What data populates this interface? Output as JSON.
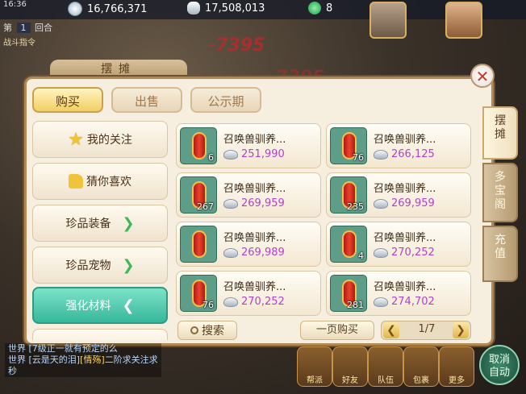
{
  "status": {
    "time": "16:36"
  },
  "currencies": [
    {
      "icon": "gold-coin-icon",
      "value": "16,766,371"
    },
    {
      "icon": "silver-ingot-icon",
      "value": "17,508,013"
    },
    {
      "icon": "jade-gem-icon",
      "value": "8"
    }
  ],
  "battle": {
    "round_label": "第",
    "round_num": "1",
    "round_unit": "回合",
    "command": "战斗指令",
    "damage1": "-7395",
    "damage2": "-7395"
  },
  "panel": {
    "title": "摆摊",
    "tabs": [
      {
        "label": "购买",
        "active": true
      },
      {
        "label": "出售",
        "active": false
      },
      {
        "label": "公示期",
        "active": false
      }
    ],
    "sidebar": [
      {
        "label": "我的关注",
        "icon": "star-icon",
        "active": false
      },
      {
        "label": "猜你喜欢",
        "icon": "thumbs-up-icon",
        "active": false
      },
      {
        "label": "珍品装备",
        "chevron": "❯",
        "active": false
      },
      {
        "label": "珍品宠物",
        "chevron": "❯",
        "active": false
      },
      {
        "label": "强化材料",
        "chevron": "❮",
        "active": true
      }
    ],
    "items": [
      {
        "name": "召唤兽驯养...",
        "qty": "6",
        "price": "251,990"
      },
      {
        "name": "召唤兽驯养...",
        "qty": "76",
        "price": "266,125"
      },
      {
        "name": "召唤兽驯养...",
        "qty": "267",
        "price": "269,959"
      },
      {
        "name": "召唤兽驯养...",
        "qty": "235",
        "price": "269,959"
      },
      {
        "name": "召唤兽驯养...",
        "qty": "",
        "price": "269,989"
      },
      {
        "name": "召唤兽驯养...",
        "qty": "4",
        "price": "270,252"
      },
      {
        "name": "召唤兽驯养...",
        "qty": "76",
        "price": "270,252"
      },
      {
        "name": "召唤兽驯养...",
        "qty": "281",
        "price": "274,702"
      }
    ],
    "search_label": "搜索",
    "buy_page_label": "一页购买",
    "pager": {
      "prev": "❮",
      "text": "1/7",
      "next": "❯"
    },
    "side_tabs": [
      {
        "label": "摆\n摊",
        "active": true
      },
      {
        "label": "多\n宝\n阁",
        "active": false
      },
      {
        "label": "充\n值",
        "active": false
      }
    ]
  },
  "chat": [
    {
      "channel": "世界",
      "text": "[7级正一就有预定的么"
    },
    {
      "channel": "世界",
      "text": "[云是天的泪]",
      "highlight": "[情殇]",
      "rest": "二阶求关注求"
    },
    {
      "channel": "",
      "text": "秒"
    }
  ],
  "bottom": {
    "auto_label": "取消\n自动",
    "buttons": [
      "帮派",
      "好友",
      "队伍",
      "包裹",
      "更多"
    ]
  }
}
